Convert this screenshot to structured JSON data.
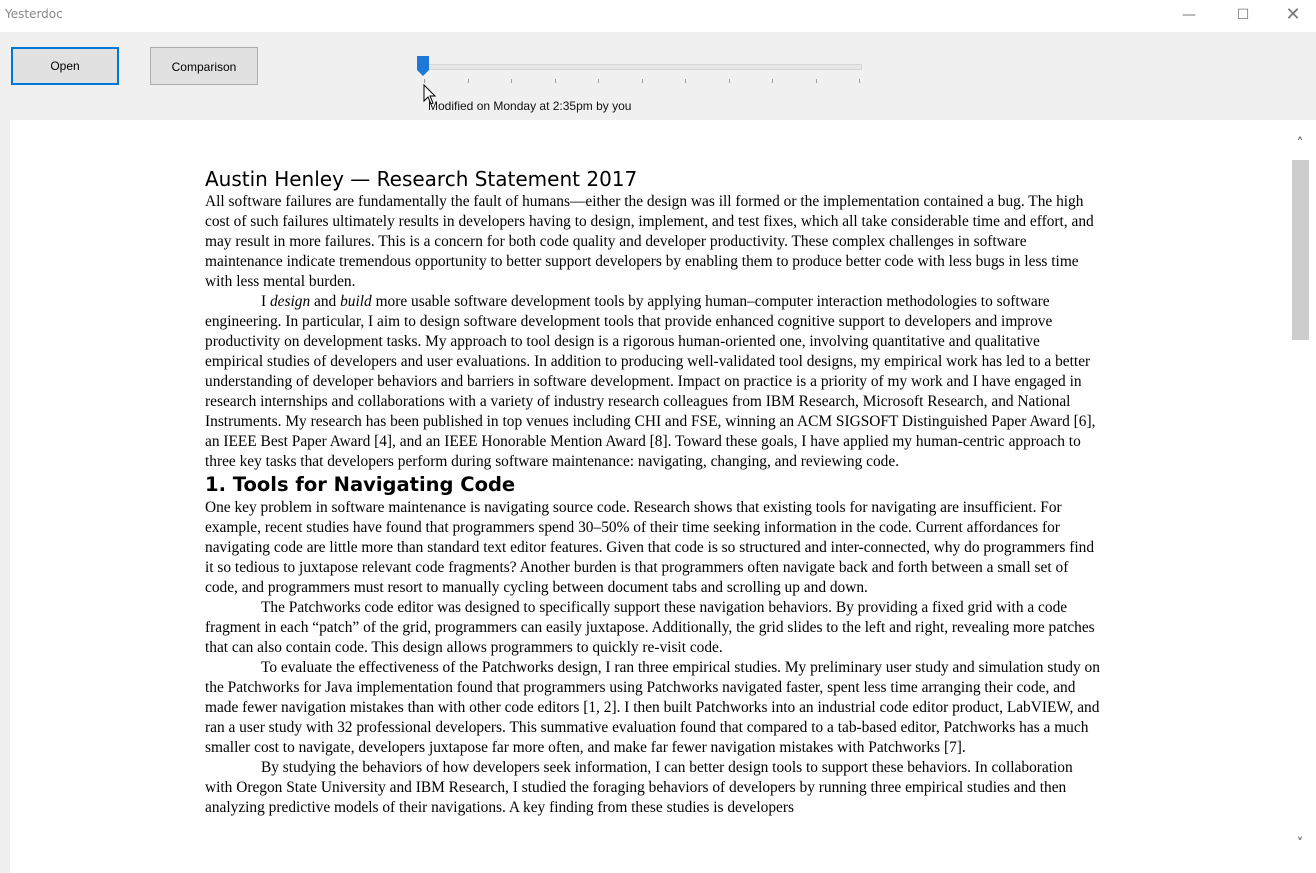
{
  "window": {
    "title": "Yesterdoc",
    "minimize_glyph": "—",
    "maximize_glyph": "☐",
    "close_glyph": "✕"
  },
  "toolbar": {
    "open_label": "Open",
    "comparison_label": "Comparison"
  },
  "timeline": {
    "modified_text": "Modified on Monday at 2:35pm by you",
    "tick_count": 11,
    "position": 0
  },
  "scrollbar": {
    "up_glyph": "˄",
    "down_glyph": "˅"
  },
  "document": {
    "title": "Austin Henley — Research Statement 2017",
    "p1": "All software failures are fundamentally the fault of humans—either the design was ill formed or the implementation contained a bug. The high cost of such failures ultimately results in developers having to design, implement, and test fixes, which all take considerable time and effort, and may result in more failures. This is a concern for both code quality and developer productivity. These complex challenges in software maintenance indicate tremendous opportunity to better support developers by enabling them to produce better code with less bugs in less time with less mental burden.",
    "p2_a": "I ",
    "p2_design": "design",
    "p2_b": " and ",
    "p2_build": "build",
    "p2_c": " more usable software development tools by applying human–computer interaction methodologies to software engineering. In particular, I aim to design software development tools that provide enhanced cognitive support to developers and improve productivity on development tasks. My approach to tool design is a rigorous human-oriented one, involving quantitative and qualitative empirical studies of developers and user evaluations. In addition to producing well-validated tool designs, my empirical work has led to a better understanding of developer behaviors and barriers in software development. Impact on practice is a priority of my work and I have engaged in research internships and collaborations with a variety of industry research colleagues from IBM Research, Microsoft Research, and National Instruments. My research has been published in top venues including CHI and FSE, winning an ACM SIGSOFT Distinguished Paper Award [6], an IEEE Best Paper Award [4], and an IEEE Honorable Mention Award [8]. Toward these goals, I have applied my human-centric approach to three key tasks that developers perform during software maintenance: navigating, changing, and reviewing code.",
    "heading1": "1. Tools for Navigating Code",
    "p3": "One key problem in software maintenance is navigating source code. Research shows that existing tools for navigating are insufficient. For example, recent studies have found that programmers spend 30–50% of their time seeking information in the code. Current affordances for navigating code are little more than standard text editor features. Given that code is so structured and inter-connected, why do programmers find it so tedious to juxtapose relevant code fragments? Another burden is that programmers often navigate back and forth between a small set of code, and programmers must resort to manually cycling between document tabs and scrolling up and down.",
    "p4": "The Patchworks code editor was designed to specifically support these navigation behaviors. By providing a fixed grid with a code fragment in each “patch” of the grid, programmers can easily juxtapose. Additionally, the grid slides to the left and right, revealing more patches that can also contain code. This design allows programmers to quickly re-visit code.",
    "p5": "To evaluate the effectiveness of the Patchworks design, I ran three empirical studies. My preliminary user study and simulation study on the Patchworks for Java implementation found that programmers using Patchworks navigated faster, spent less time arranging their code, and made fewer navigation mistakes than with other code editors [1, 2]. I then built Patchworks into an industrial code editor product, LabVIEW, and ran a user study with 32 professional developers. This summative evaluation found that compared to a tab-based editor, Patchworks has a much smaller cost to navigate, developers juxtapose far more often, and make far fewer navigation mistakes with Patchworks [7].",
    "p6": "By studying the behaviors of how developers seek information, I can better design tools to support these behaviors. In collaboration with Oregon State University and IBM Research, I studied the foraging behaviors of developers by running three empirical studies and then analyzing predictive models of their navigations. A key finding from these studies is developers"
  },
  "colors": {
    "accent": "#0078d7",
    "thumb": "#1e78d7"
  }
}
